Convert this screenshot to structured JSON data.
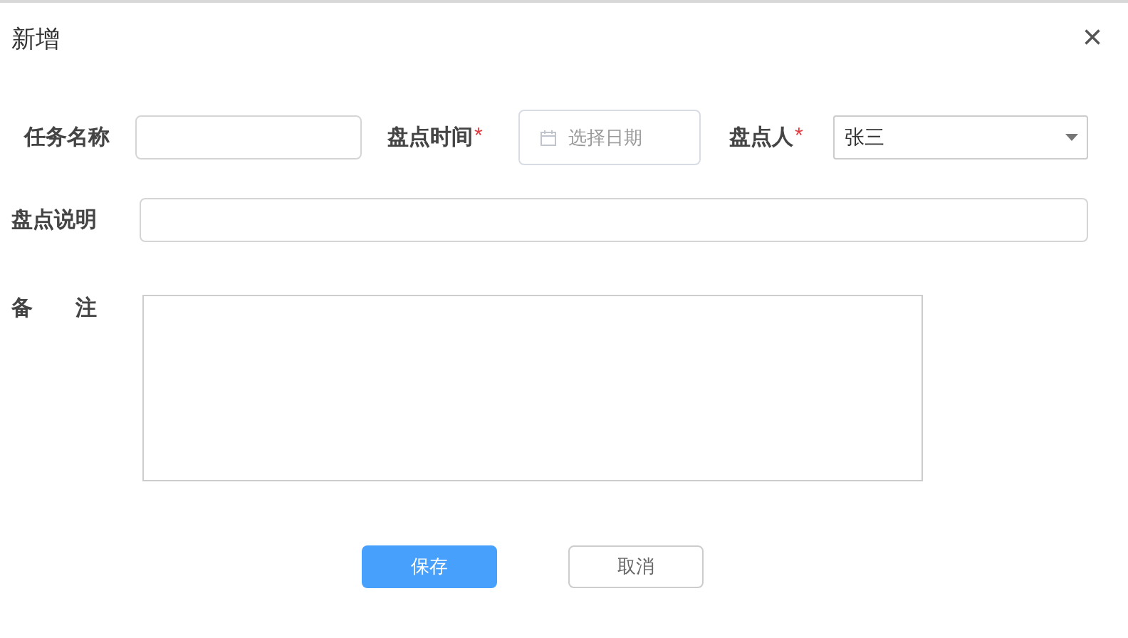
{
  "dialog": {
    "title": "新增",
    "close": "×"
  },
  "required_mark": "*",
  "row_1": [
    {
      "kind": "text",
      "label": "任务名称",
      "required": false
    },
    {
      "kind": "date",
      "label": "盘点时间",
      "required": true,
      "placeholder": "选择日期"
    },
    {
      "kind": "select",
      "label": "盘点人",
      "required": true,
      "value": "张三"
    }
  ],
  "description": {
    "label": "盘点说明",
    "required": false
  },
  "remarks": {
    "label": "备　　注",
    "required": false
  },
  "buttons": [
    {
      "kind": "primary",
      "label": "保存"
    },
    {
      "kind": "default",
      "label": "取消"
    }
  ]
}
